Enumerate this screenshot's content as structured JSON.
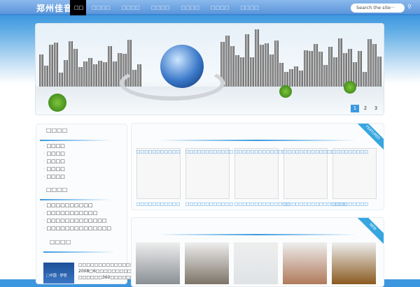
{
  "header": {
    "logo": "郑州佳音",
    "nav": [
      "□□",
      "□□□□",
      "□□□□",
      "□□□□",
      "□□□□",
      "□□□□",
      "□□□□"
    ],
    "search_placeholder": "Search the site···"
  },
  "banner": {
    "pages": [
      "1",
      "2",
      "3"
    ],
    "active_page": "1"
  },
  "sidebar": {
    "section1": {
      "title": "□□□□",
      "items": [
        "□□□□",
        "□□□□",
        "□□□□",
        "□□□□",
        "□□□□"
      ]
    },
    "section2": {
      "title": "□□□□",
      "items": [
        "□□□□□□□□□□",
        "□□□□□□□□□□□",
        "□□□□□□□□□□□□□",
        "□□□□□□□□□□□□□□"
      ]
    },
    "section3": {
      "title": "□□□□",
      "ad_image_text": "□中国 · 梦想",
      "text": [
        "□□□□□□□□□□□□□□",
        "2008□6□□□□□□□□□□□",
        "□□□□□□360□□□□□□"
      ]
    }
  },
  "featured": {
    "ribbon": "FEATURED",
    "items": [
      {
        "top": "□□□□□□□□□□□",
        "bottom": "□□□□□□□□□□□"
      },
      {
        "top": "□□□□□□□□□□□□",
        "bottom": "□□□□□□□□□□□□"
      },
      {
        "top": "□□□□□□□□□□□□□□",
        "bottom": "□□□□□□□□□□□□□□"
      },
      {
        "top": "□□□□□□□□□□□□□□□□",
        "bottom": "□□□□□□□□□□□□□□□□"
      },
      {
        "top": "□□□□□□□□□",
        "bottom": "□□□□□□□□□"
      }
    ]
  },
  "new": {
    "ribbon": "NEW",
    "photos": [
      "car-interior",
      "building-entrance",
      "plaza",
      "auditorium",
      "shop-front"
    ],
    "colors": [
      "#8a8f94",
      "#7d7468",
      "#dfe3e6",
      "#b07a5a",
      "#8a5a20"
    ]
  }
}
